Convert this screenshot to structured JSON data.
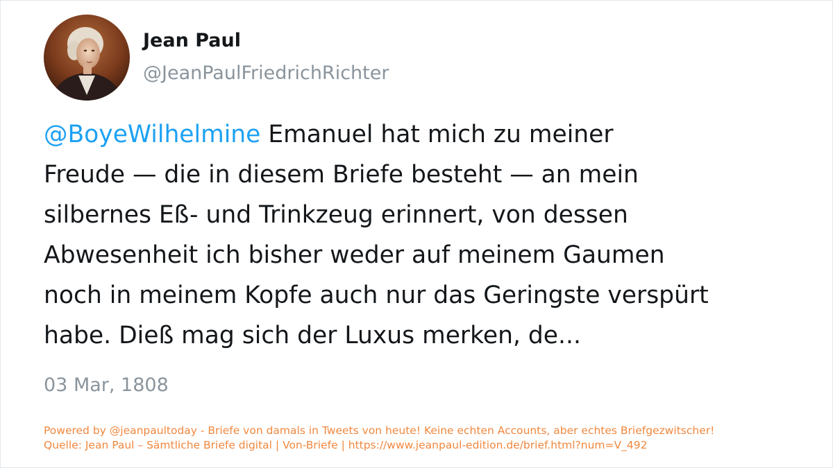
{
  "tweet": {
    "display_name": "Jean Paul",
    "handle": "@JeanPaulFriedrichRichter",
    "avatar_icon": "portrait-avatar-icon",
    "mention": "@BoyeWilhelmine",
    "text_lines": [
      " Emanuel hat mich zu meiner",
      "Freude — die in diesem Briefe besteht — an mein",
      "silbernes Eß- und Trinkzeug erinnert, von dessen",
      "Abwesenheit ich bisher weder auf meinem Gaumen",
      "noch in meinem Kopfe auch nur das Geringste verspürt",
      "habe. Dieß mag sich der Luxus merken, de..."
    ],
    "date": "03 Mar, 1808"
  },
  "footer": {
    "powered_by": "Powered by @jeanpaultoday - Briefe von damals in Tweets von heute! Keine echten Accounts, aber echtes Briefgezwitscher!",
    "source": "Quelle: Jean Paul – Sämtliche Briefe digital | Von-Briefe | https://www.jeanpaul-edition.de/brief.html?num=V_492"
  },
  "colors": {
    "mention": "#1da1f2",
    "text": "#14171a",
    "muted": "#8a949c",
    "footer": "#f0883e",
    "border": "#e1e8ed"
  }
}
